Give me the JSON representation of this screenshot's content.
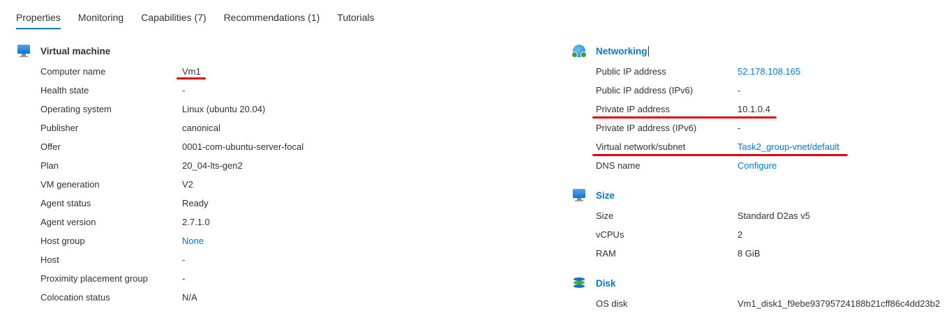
{
  "tabs": [
    {
      "label": "Properties"
    },
    {
      "label": "Monitoring"
    },
    {
      "label": "Capabilities (7)"
    },
    {
      "label": "Recommendations (1)"
    },
    {
      "label": "Tutorials"
    }
  ],
  "vm": {
    "title": "Virtual machine",
    "icon": "monitor-icon",
    "rows": [
      {
        "label": "Computer name",
        "value": "Vm1"
      },
      {
        "label": "Health state",
        "value": "-"
      },
      {
        "label": "Operating system",
        "value": "Linux (ubuntu 20.04)"
      },
      {
        "label": "Publisher",
        "value": "canonical"
      },
      {
        "label": "Offer",
        "value": "0001-com-ubuntu-server-focal"
      },
      {
        "label": "Plan",
        "value": "20_04-lts-gen2"
      },
      {
        "label": "VM generation",
        "value": "V2"
      },
      {
        "label": "Agent status",
        "value": "Ready"
      },
      {
        "label": "Agent version",
        "value": "2.7.1.0"
      },
      {
        "label": "Host group",
        "value": "None"
      },
      {
        "label": "Host",
        "value": "-"
      },
      {
        "label": "Proximity placement group",
        "value": "-"
      },
      {
        "label": "Colocation status",
        "value": "N/A"
      }
    ]
  },
  "networking": {
    "title": "Networking",
    "icon": "networking-icon",
    "rows": [
      {
        "label": "Public IP address",
        "value": "52.178.108.165"
      },
      {
        "label": "Public IP address (IPv6)",
        "value": "-"
      },
      {
        "label": "Private IP address",
        "value": "10.1.0.4"
      },
      {
        "label": "Private IP address (IPv6)",
        "value": "-"
      },
      {
        "label": "Virtual network/subnet",
        "value": "Task2_group-vnet/default"
      },
      {
        "label": "DNS name",
        "value": "Configure"
      }
    ]
  },
  "size": {
    "title": "Size",
    "icon": "size-monitor-icon",
    "rows": [
      {
        "label": "Size",
        "value": "Standard D2as v5"
      },
      {
        "label": "vCPUs",
        "value": "2"
      },
      {
        "label": "RAM",
        "value": "8 GiB"
      }
    ]
  },
  "disk": {
    "title": "Disk",
    "icon": "disk-icon",
    "rows": [
      {
        "label": "OS disk",
        "value": "Vm1_disk1_f9ebe93795724188b21cff86c4dd23b2"
      }
    ]
  },
  "colors": {
    "accent": "#0078d4",
    "annotation": "#e3000f",
    "text": "#323130"
  }
}
